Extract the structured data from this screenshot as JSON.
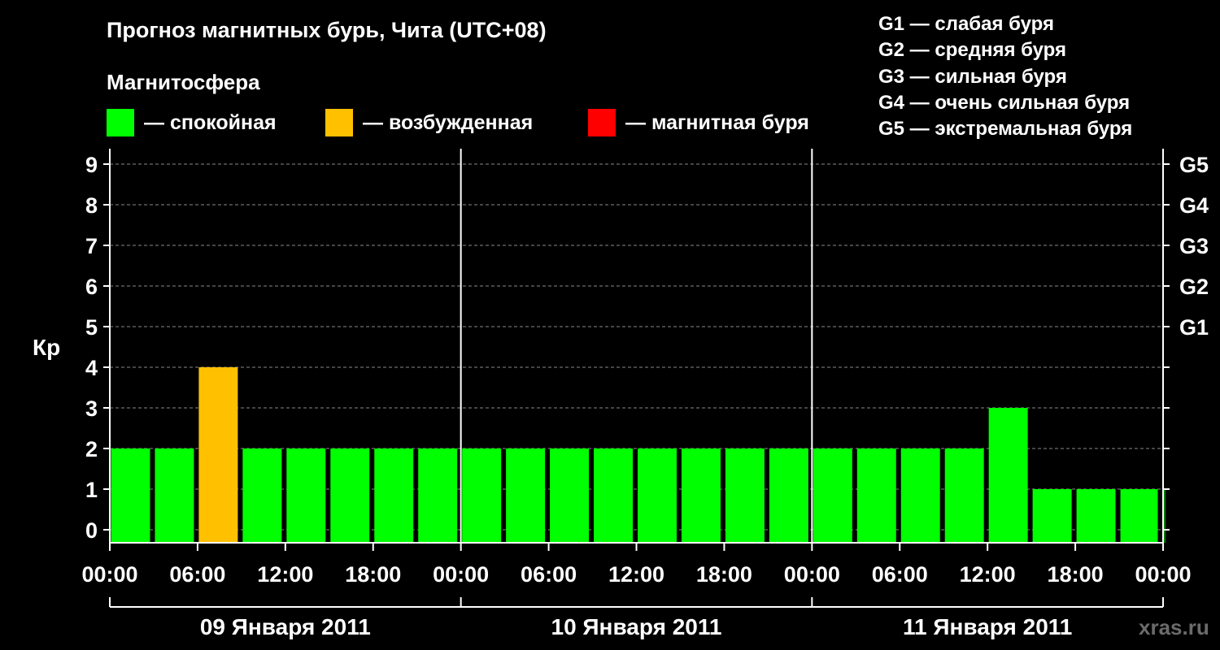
{
  "chart_data": {
    "type": "bar",
    "title": "Прогноз магнитных бурь, Чита (UTC+08)",
    "subtitle": "Магнитосфера",
    "ylabel": "Кр",
    "ylim": [
      0,
      9
    ],
    "yticks": [
      "0",
      "1",
      "2",
      "3",
      "4",
      "5",
      "6",
      "7",
      "8",
      "9"
    ],
    "storm_axis": [
      {
        "kp": 5,
        "label": "G1"
      },
      {
        "kp": 6,
        "label": "G2"
      },
      {
        "kp": 7,
        "label": "G3"
      },
      {
        "kp": 8,
        "label": "G4"
      },
      {
        "kp": 9,
        "label": "G5"
      }
    ],
    "interval_hours": 3,
    "xticks": [
      "00:00",
      "06:00",
      "12:00",
      "18:00",
      "00:00",
      "06:00",
      "12:00",
      "18:00",
      "00:00",
      "06:00",
      "12:00",
      "18:00",
      "00:00"
    ],
    "days": [
      "09 Января 2011",
      "10 Января 2011",
      "11 Января 2011"
    ],
    "values": [
      2,
      2,
      4,
      2,
      2,
      2,
      2,
      2,
      2,
      2,
      2,
      2,
      2,
      2,
      2,
      2,
      2,
      2,
      2,
      2,
      3,
      1,
      1,
      1,
      1
    ],
    "status_levels": [
      "calm",
      "calm",
      "excited",
      "calm",
      "calm",
      "calm",
      "calm",
      "calm",
      "calm",
      "calm",
      "calm",
      "calm",
      "calm",
      "calm",
      "calm",
      "calm",
      "calm",
      "calm",
      "calm",
      "calm",
      "calm",
      "calm",
      "calm",
      "calm",
      "calm"
    ],
    "legend": [
      {
        "key": "calm",
        "label": "— спокойная",
        "color": "#00ff00"
      },
      {
        "key": "excited",
        "label": "— возбужденная",
        "color": "#ffc000"
      },
      {
        "key": "storm",
        "label": "— магнитная буря",
        "color": "#ff0000"
      }
    ],
    "storm_levels": [
      "G1 — слабая буря",
      "G2 — средняя буря",
      "G3 — сильная буря",
      "G4 — очень сильная буря",
      "G5 — экстремальная буря"
    ],
    "grid": true
  },
  "watermark": "xras.ru"
}
